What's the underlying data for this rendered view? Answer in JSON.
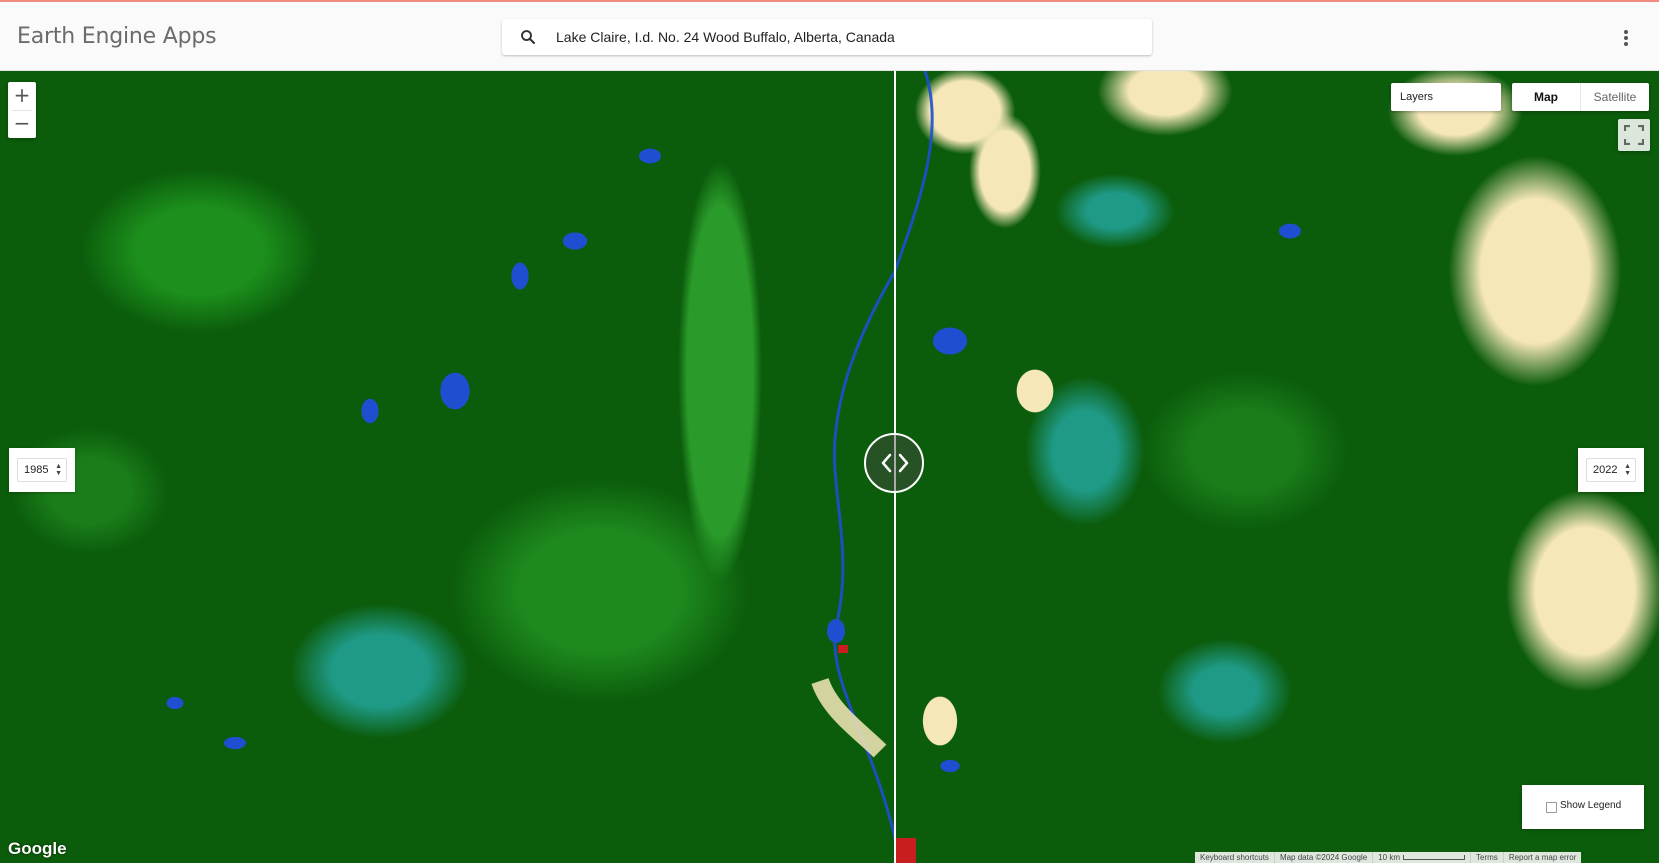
{
  "header": {
    "app_title": "Earth Engine Apps",
    "search_value": "Lake Claire, I.d. No. 24 Wood Buffalo, Alberta, Canada",
    "search_icon": "search-icon",
    "menu_icon": "more-vert-icon"
  },
  "map": {
    "zoom_in": "+",
    "zoom_out": "−",
    "layers_label": "Layers",
    "map_type": {
      "map": "Map",
      "satellite": "Satellite",
      "selected": "Map"
    },
    "fullscreen_icon": "fullscreen-icon",
    "swipe_icon": "swipe-arrows-icon",
    "left_year": "1985",
    "right_year": "2022",
    "show_legend_label": "Show Legend",
    "show_legend_checked": false,
    "google_logo": "Google",
    "attribution": {
      "keyboard": "Keyboard shortcuts",
      "map_data": "Map data ©2024 Google",
      "scale": "10 km",
      "terms": "Terms",
      "report": "Report a map error"
    },
    "colors": {
      "forest_dark": "#0b5c0b",
      "forest_light": "#2a9a2a",
      "wetland_teal": "#1f9a86",
      "water": "#1f4fd0",
      "barren": "#f6e7b8",
      "developed": "#c81e1e"
    }
  }
}
